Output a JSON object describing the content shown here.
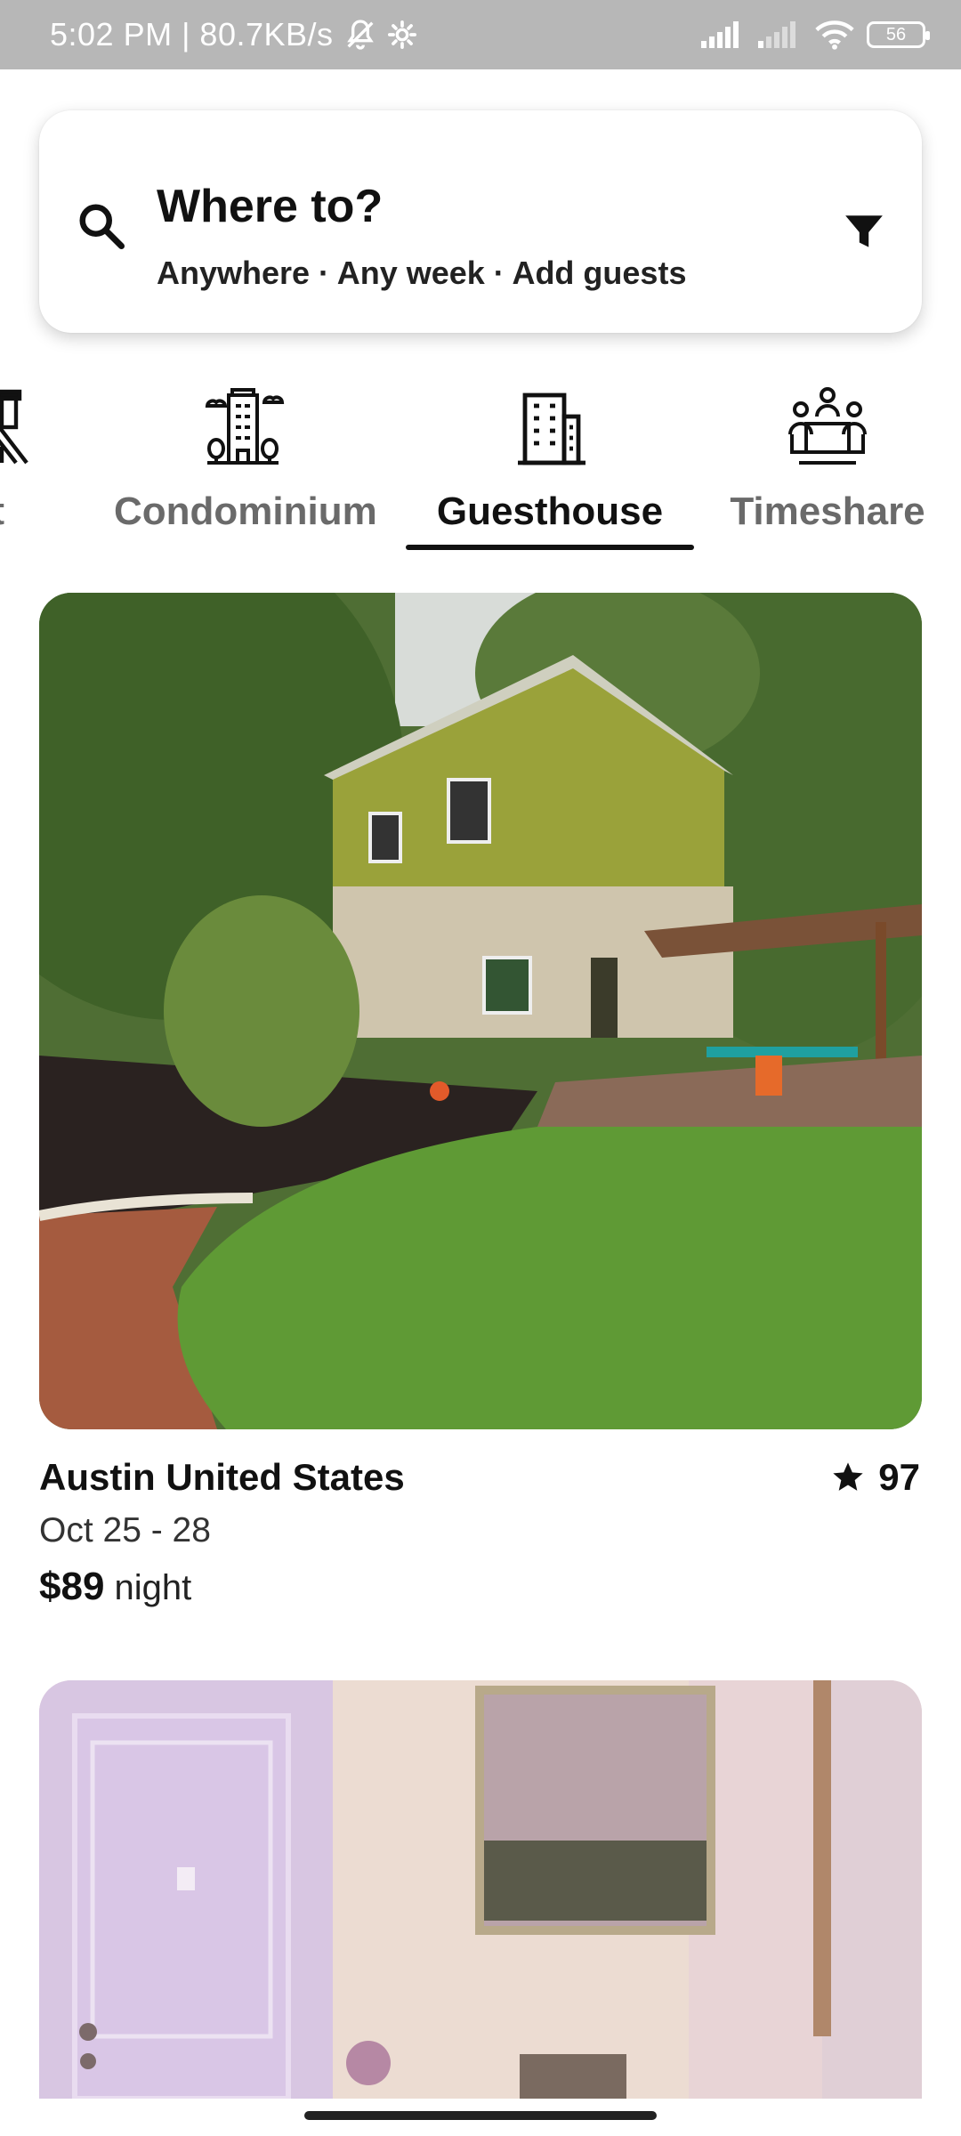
{
  "status_bar": {
    "time_speed": "5:02 PM | 80.7KB/s",
    "battery": "56"
  },
  "search": {
    "title": "Where to?",
    "subtitle": "Anywhere · Any week · Add guests"
  },
  "categories": [
    {
      "label": "Loft",
      "icon": "loft-icon",
      "active": false
    },
    {
      "label": "Condominium",
      "icon": "condominium-icon",
      "active": false
    },
    {
      "label": "Guesthouse",
      "icon": "guesthouse-icon",
      "active": true
    },
    {
      "label": "Timeshare",
      "icon": "timeshare-icon",
      "active": false
    }
  ],
  "listings": [
    {
      "location": "Austin United States",
      "dates": "Oct 25 - 28",
      "price": "$89",
      "price_unit": "night",
      "rating": "97"
    }
  ],
  "colors": {
    "status_bar": "#b7b7b7",
    "active_tab": "#111111",
    "inactive_tab": "#6a6a6a"
  }
}
